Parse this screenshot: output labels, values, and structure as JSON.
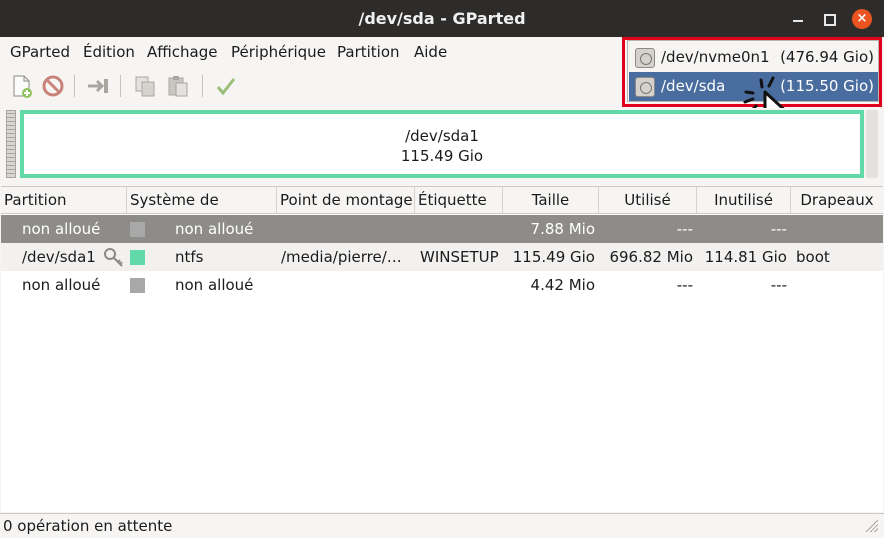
{
  "window": {
    "title": "/dev/sda - GParted",
    "close_glyph": "×"
  },
  "menu": [
    "GParted",
    "Édition",
    "Affichage",
    "Périphérique",
    "Partition",
    "Aide"
  ],
  "toolbar": {
    "buttons": [
      "new-icon",
      "delete-icon",
      "resize-move-icon",
      "copy-icon",
      "paste-icon",
      "apply-icon"
    ]
  },
  "devices": [
    {
      "name": "/dev/nvme0n1",
      "size": "(476.94 Gio)",
      "selected": false
    },
    {
      "name": "/dev/sda",
      "size": "(115.50 Gio)",
      "selected": true
    }
  ],
  "accent_colors": {
    "highlight": "#e0001b",
    "ntfs": "#62d9a9",
    "unallocated": "#a8a8a8",
    "selection": "#4a6da0"
  },
  "diskmap": {
    "partition": "/dev/sda1",
    "size": "115.49 Gio"
  },
  "table": {
    "headers": [
      "Partition",
      "Système de fichiers",
      "Point de montage",
      "Étiquette",
      "Taille",
      "Utilisé",
      "Inutilisé",
      "Drapeaux"
    ],
    "rows": [
      {
        "partition": "non alloué",
        "fs": "non alloué",
        "mount": "",
        "label": "",
        "size": "7.88 Mio",
        "used": "---",
        "unused": "---",
        "flags": "",
        "fs_color": "#a8a8a8",
        "key": false
      },
      {
        "partition": "/dev/sda1",
        "fs": "ntfs",
        "mount": "/media/pierre/…",
        "label": "WINSETUP",
        "size": "115.49 Gio",
        "used": "696.82 Mio",
        "unused": "114.81 Gio",
        "flags": "boot",
        "fs_color": "#62d9a9",
        "key": true
      },
      {
        "partition": "non alloué",
        "fs": "non alloué",
        "mount": "",
        "label": "",
        "size": "4.42 Mio",
        "used": "---",
        "unused": "---",
        "flags": "",
        "fs_color": "#a8a8a8",
        "key": false
      }
    ]
  },
  "status": {
    "text": "0 opération en attente"
  }
}
